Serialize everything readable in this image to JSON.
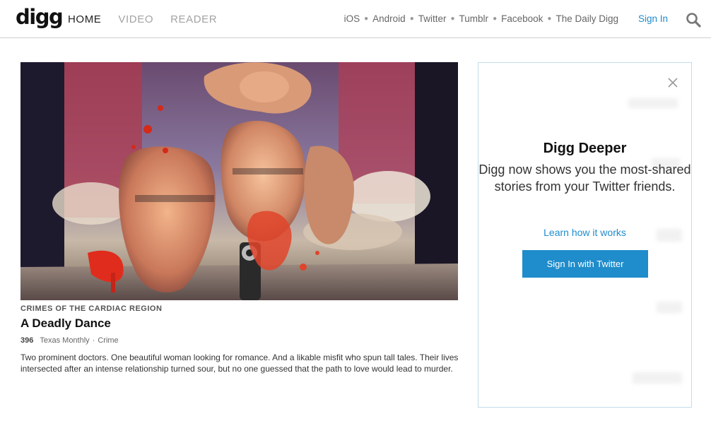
{
  "header": {
    "logo": "digg",
    "nav": [
      "HOME",
      "VIDEO",
      "READER"
    ],
    "external_links": [
      "iOS",
      "Android",
      "Twitter",
      "Tumblr",
      "Facebook",
      "The Daily Digg"
    ],
    "sign_in": "Sign In",
    "search_icon": "search-icon"
  },
  "story": {
    "kicker": "CRIMES OF THE CARDIAC REGION",
    "title": "A Deadly Dance",
    "digg_count": "396",
    "source": "Texas Monthly",
    "category": "Crime",
    "summary": "Two prominent doctors. One beautiful woman looking for romance. And a likable misfit who spun tall tales. Their lives intersected after an intense relationship turned sour, but no one guessed that the path to love would lead to murder."
  },
  "panel": {
    "title": "Digg Deeper",
    "text": "Digg now shows you the most-shared stories from your Twitter friends.",
    "learn_link": "Learn how it works",
    "button": "Sign In with Twitter",
    "close_icon": "close-icon"
  },
  "colors": {
    "link_blue": "#1f8ccb",
    "panel_border": "#c5dce9"
  }
}
